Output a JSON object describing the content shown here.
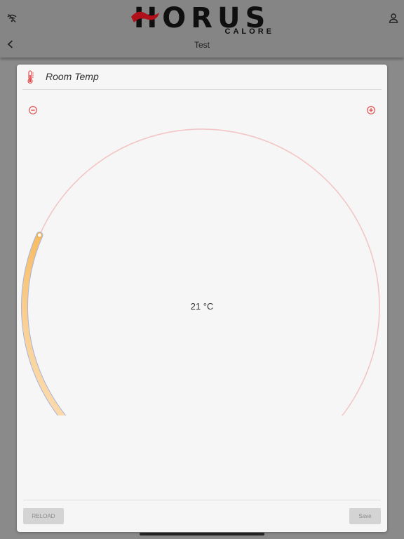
{
  "header": {
    "logo_main": "HORUS",
    "logo_sub": "CALORE",
    "title": "Test",
    "icons": {
      "wifi": "wifi-off-icon",
      "user": "user-icon",
      "back": "chevron-left-icon"
    }
  },
  "card": {
    "title": "Room Temp",
    "title_icon": "thermometer-icon",
    "minus_icon": "minus-circle-icon",
    "plus_icon": "plus-circle-icon"
  },
  "gauge": {
    "value_text": "21 °C",
    "fill_fraction": 0.27
  },
  "footer": {
    "reload_label": "RELOAD",
    "save_label": "Save"
  },
  "colors": {
    "accent": "#e04040",
    "gauge_fill_start": "#fde8cc",
    "gauge_fill_end": "#f7b85a",
    "gauge_outline": "#a8b4dc",
    "gauge_track": "#f3c6c6"
  }
}
